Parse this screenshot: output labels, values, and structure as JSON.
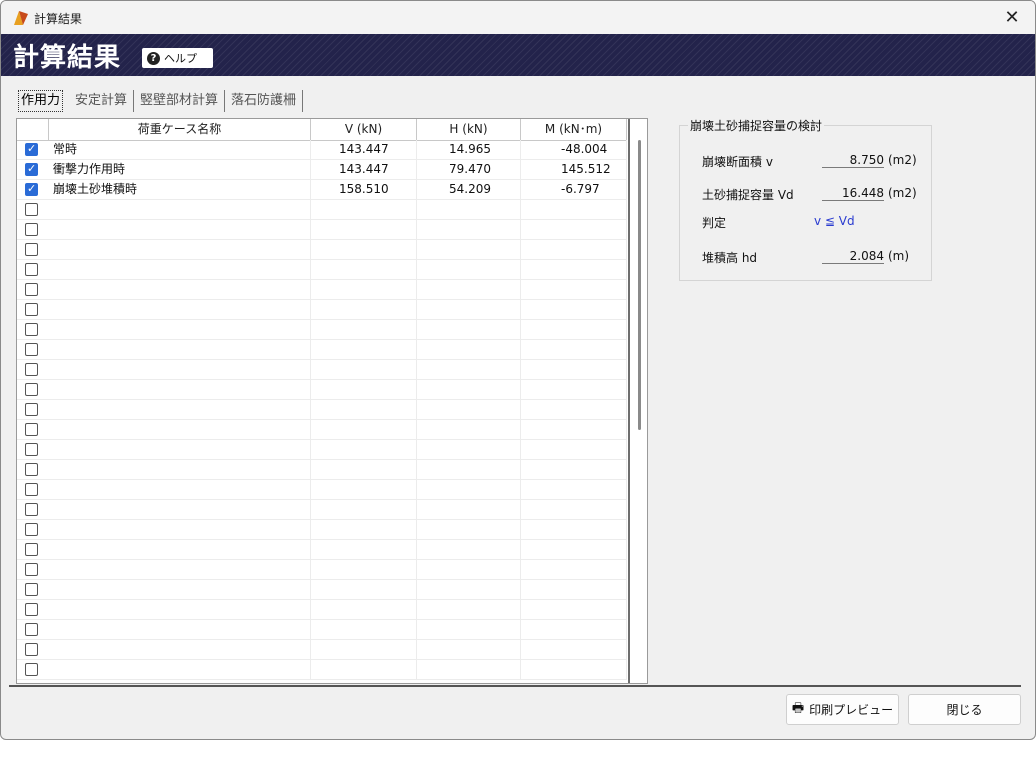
{
  "window": {
    "title": "計算結果",
    "close_glyph": "✕"
  },
  "header": {
    "title": "計算結果",
    "help_label": "ヘルプ",
    "help_icon": "?"
  },
  "tabs": [
    {
      "label": "作用力",
      "active": true
    },
    {
      "label": "安定計算",
      "active": false
    },
    {
      "label": "竪壁部材計算",
      "active": false
    },
    {
      "label": "落石防護柵",
      "active": false
    }
  ],
  "grid": {
    "columns": {
      "name": "荷重ケース名称",
      "v": "V (kN)",
      "h": "H (kN)",
      "m": "M (kN･m)"
    },
    "rows": [
      {
        "checked": true,
        "name": "常時",
        "v": "143.447",
        "h": "14.965",
        "m": "-48.004"
      },
      {
        "checked": true,
        "name": "衝撃力作用時",
        "v": "143.447",
        "h": "79.470",
        "m": "145.512"
      },
      {
        "checked": true,
        "name": "崩壊土砂堆積時",
        "v": "158.510",
        "h": "54.209",
        "m": "-6.797"
      }
    ],
    "empty_row_count": 24
  },
  "capacity": {
    "title": "崩壊土砂捕捉容量の検討",
    "area_label": "崩壊断面積 v",
    "area_value": "8.750",
    "area_unit": "(m2)",
    "cap_label": "土砂捕捉容量 Vd",
    "cap_value": "16.448",
    "cap_unit": "(m2)",
    "judge_label": "判定",
    "judge_value": "v ≦ Vd",
    "height_label": "堆積高 hd",
    "height_value": "2.084",
    "height_unit": "(m)"
  },
  "buttons": {
    "print_preview": "印刷プレビュー",
    "printer_icon": "🖶",
    "close": "閉じる"
  },
  "colors": {
    "header_bg": "#23234b",
    "accent": "#2a6bd6",
    "judge": "#2a3bd0"
  }
}
